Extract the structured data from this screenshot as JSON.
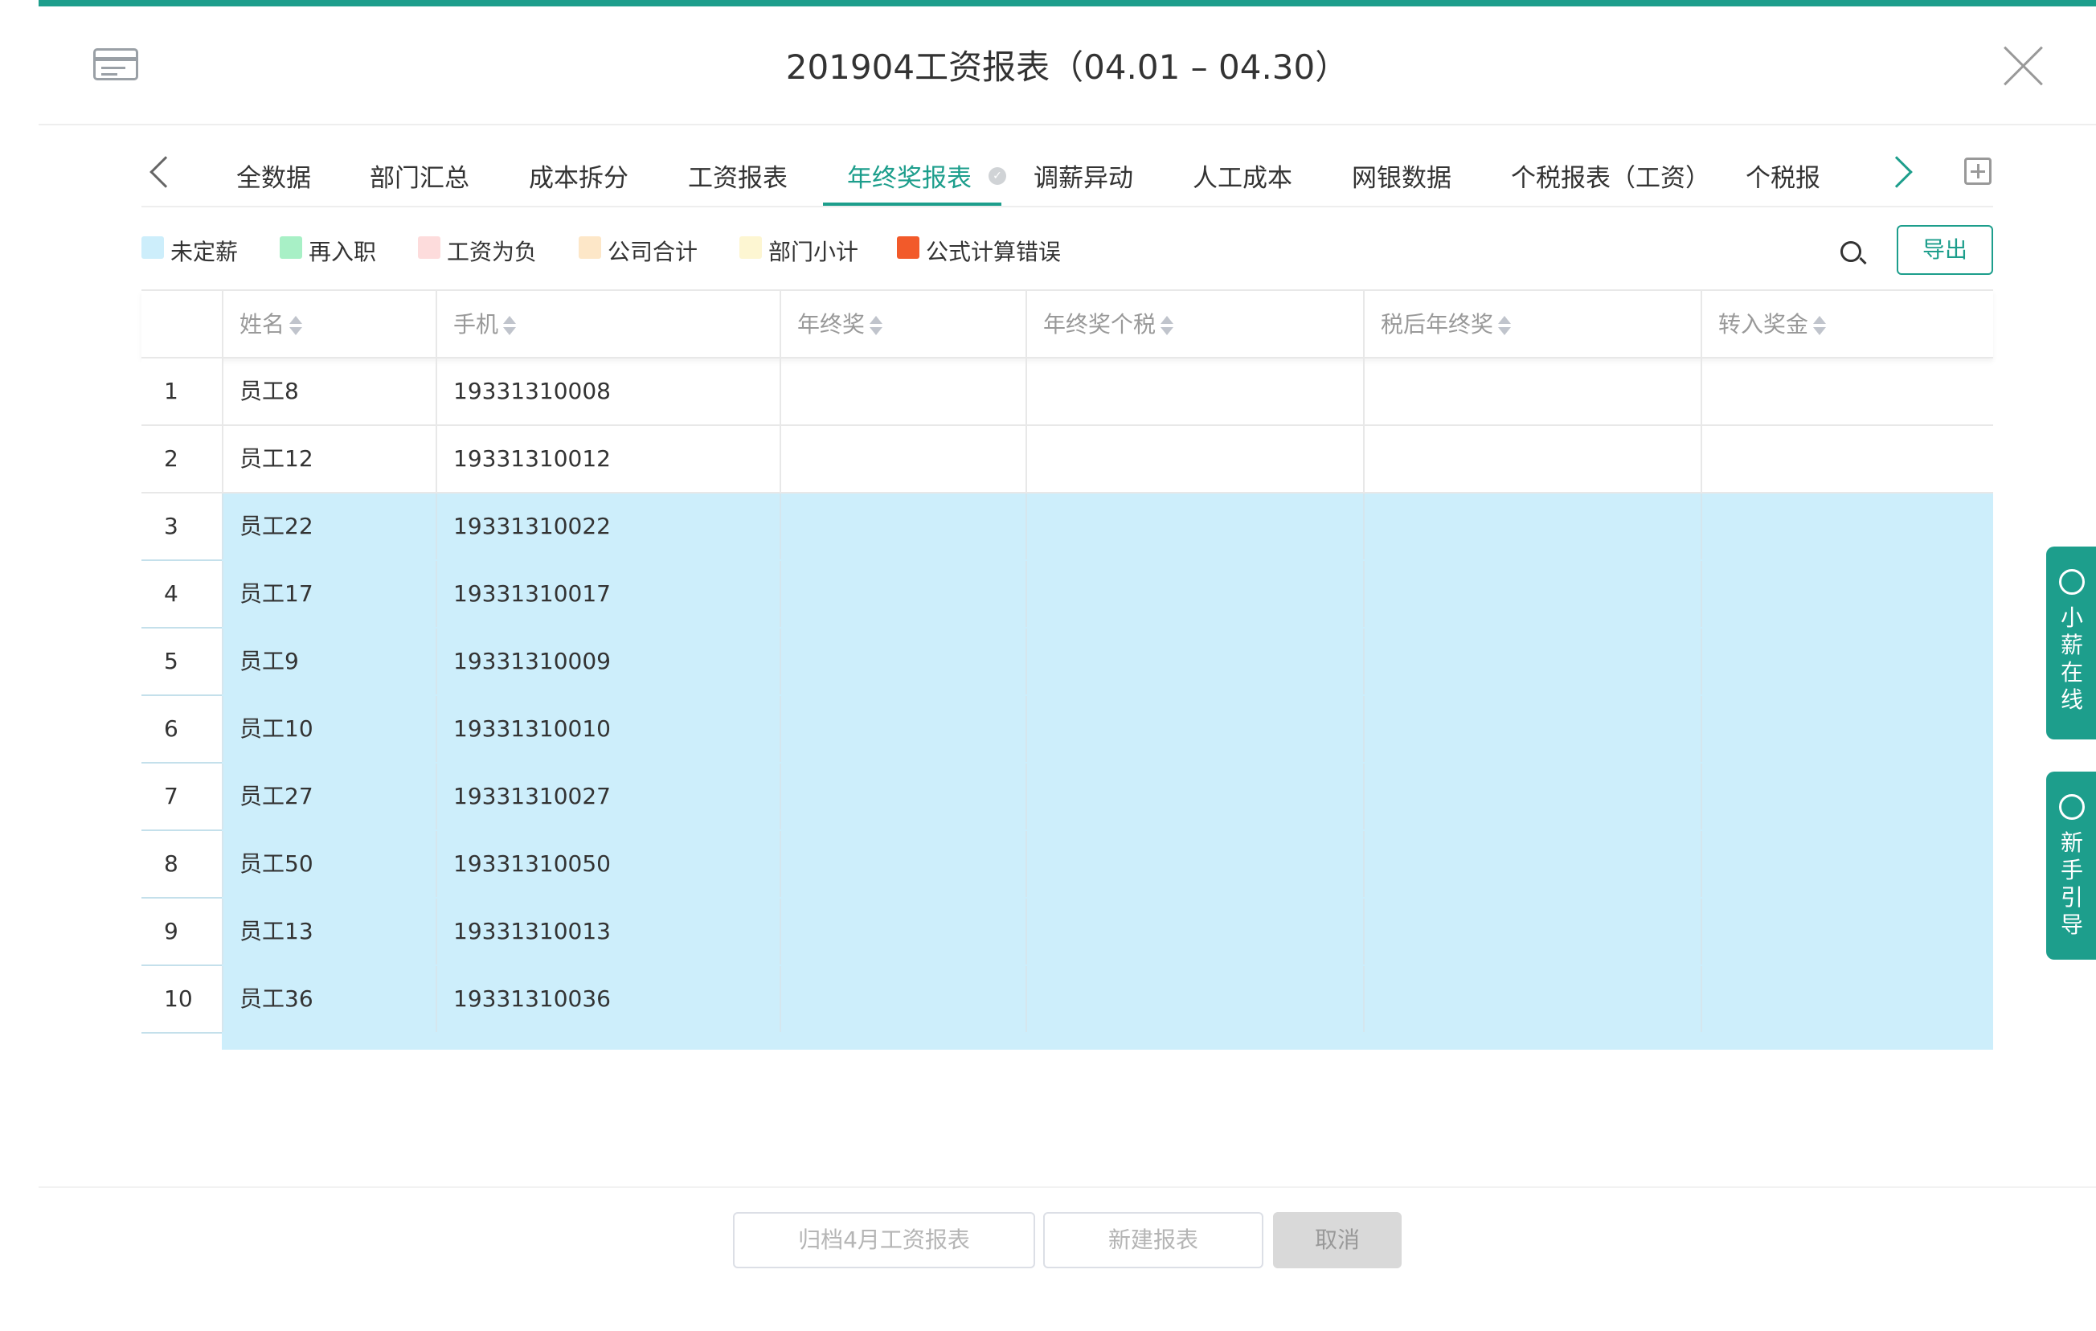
{
  "header": {
    "title": "201904工资报表（04.01 – 04.30）"
  },
  "tabs": [
    {
      "label": "全数据",
      "active": false
    },
    {
      "label": "部门汇总",
      "active": false
    },
    {
      "label": "成本拆分",
      "active": false
    },
    {
      "label": "工资报表",
      "active": false
    },
    {
      "label": "年终奖报表",
      "active": true
    },
    {
      "label": "调薪异动",
      "active": false
    },
    {
      "label": "人工成本",
      "active": false
    },
    {
      "label": "网银数据",
      "active": false
    },
    {
      "label": "个税报表（工资）",
      "active": false
    },
    {
      "label": "个税报",
      "active": false
    }
  ],
  "legend": [
    {
      "label": "未定薪",
      "color": "#cdeefb"
    },
    {
      "label": "再入职",
      "color": "#a8f0c6"
    },
    {
      "label": "工资为负",
      "color": "#fddcdc"
    },
    {
      "label": "公司合计",
      "color": "#fde7c8"
    },
    {
      "label": "部门小计",
      "color": "#fdf6d2"
    },
    {
      "label": "公式计算错误",
      "color": "#f25a2a"
    }
  ],
  "toolbar": {
    "export_label": "导出"
  },
  "table": {
    "columns": [
      "姓名",
      "手机",
      "年终奖",
      "年终奖个税",
      "税后年终奖",
      "转入奖金"
    ],
    "rows": [
      {
        "index": "1",
        "name": "员工8",
        "phone": "19331310008",
        "unset": false
      },
      {
        "index": "2",
        "name": "员工12",
        "phone": "19331310012",
        "unset": false
      },
      {
        "index": "3",
        "name": "员工22",
        "phone": "19331310022",
        "unset": true
      },
      {
        "index": "4",
        "name": "员工17",
        "phone": "19331310017",
        "unset": true
      },
      {
        "index": "5",
        "name": "员工9",
        "phone": "19331310009",
        "unset": true
      },
      {
        "index": "6",
        "name": "员工10",
        "phone": "19331310010",
        "unset": true
      },
      {
        "index": "7",
        "name": "员工27",
        "phone": "19331310027",
        "unset": true
      },
      {
        "index": "8",
        "name": "员工50",
        "phone": "19331310050",
        "unset": true
      },
      {
        "index": "9",
        "name": "员工13",
        "phone": "19331310013",
        "unset": true
      },
      {
        "index": "10",
        "name": "员工36",
        "phone": "19331310036",
        "unset": true
      }
    ]
  },
  "side": {
    "support_label": "小薪在线",
    "guide_label": "新手引导"
  },
  "footer": {
    "archive_label": "归档4月工资报表",
    "new_label": "新建报表",
    "cancel_label": "取消"
  },
  "colors": {
    "accent": "#1d9e8c",
    "unset_row": "#cdeefb"
  }
}
